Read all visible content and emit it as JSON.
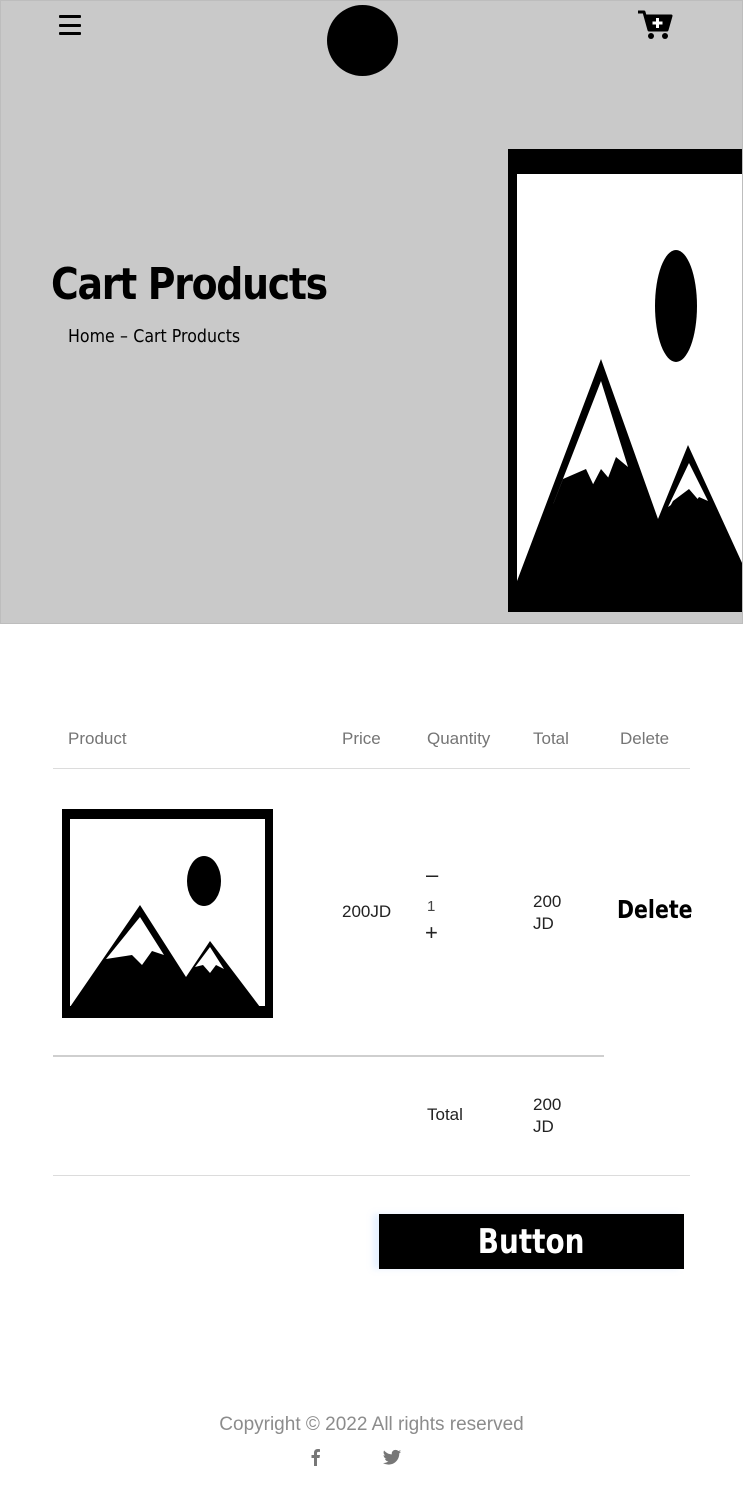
{
  "header": {
    "menu_icon": "hamburger-menu-icon",
    "logo": "logo-circle",
    "cart_icon": "cart-add-icon"
  },
  "hero": {
    "title": "Cart Products",
    "breadcrumb": {
      "home": "Home",
      "separator": "–",
      "current": "Cart Products"
    },
    "background_color": "#c9c9c9",
    "image_icon": "image-placeholder-icon"
  },
  "cart_table": {
    "columns": [
      "Product",
      "Price",
      "Quantity",
      "Total",
      "Delete"
    ],
    "rows": [
      {
        "image_icon": "image-placeholder-icon",
        "price": "200JD",
        "quantity": {
          "minus": "–",
          "value": "1",
          "plus": "+"
        },
        "total": "200 JD",
        "delete_label": "Delete"
      }
    ],
    "summary": {
      "label": "Total",
      "value": "200 JD"
    }
  },
  "checkout": {
    "button_label": "Button"
  },
  "footer": {
    "copyright": "Copyright © 2022 All rights reserved",
    "social_icons": [
      "facebook-icon",
      "twitter-icon"
    ],
    "icon_color": "#777777"
  }
}
